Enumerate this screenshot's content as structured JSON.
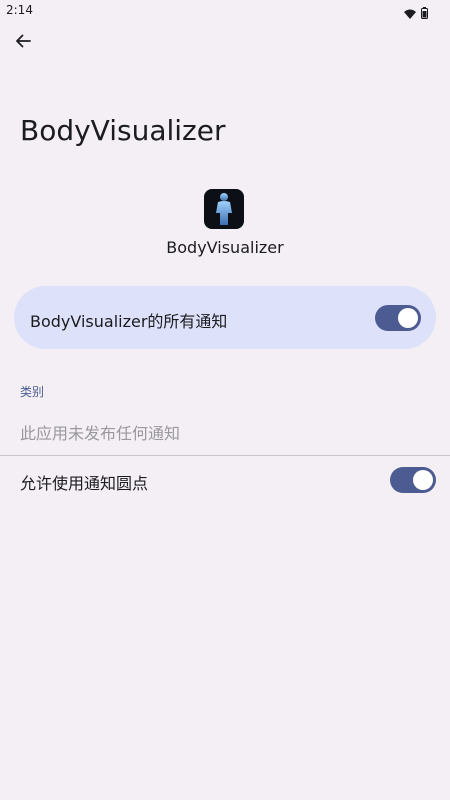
{
  "status_bar": {
    "time": "2:14",
    "icons": [
      "wifi-icon",
      "battery-icon"
    ]
  },
  "nav": {
    "back_icon": "arrow-left-icon"
  },
  "page": {
    "title": "BodyVisualizer"
  },
  "app": {
    "name": "BodyVisualizer",
    "icon": "body-figure-icon"
  },
  "main_toggle": {
    "label": "BodyVisualizer的所有通知",
    "enabled": true
  },
  "categories": {
    "header": "类别",
    "empty_message": "此应用未发布任何通知"
  },
  "notification_dots": {
    "label": "允许使用通知圆点",
    "enabled": true
  },
  "colors": {
    "background": "#f3eff4",
    "card": "#dde1f9",
    "accent": "#4c5c92",
    "muted_text": "#9a979e"
  }
}
